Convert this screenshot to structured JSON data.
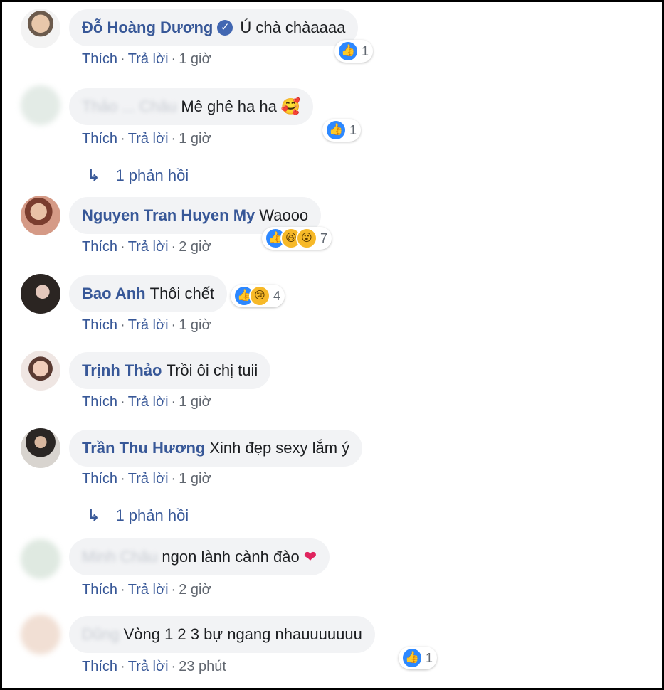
{
  "comments": [
    {
      "name": "Đỗ Hoàng Dương",
      "verified": true,
      "text": "Ú chà chàaaaa",
      "emoji": "",
      "actions": {
        "like": "Thích",
        "reply": "Trả lời",
        "time": "1 giờ"
      },
      "reaction_count": "1",
      "reaction_icons": [
        "like-icon"
      ]
    },
    {
      "name": "Thảo ... Châu",
      "text": "Mê ghê ha ha",
      "emoji": "🥰",
      "actions": {
        "like": "Thích",
        "reply": "Trả lời",
        "time": "1 giờ"
      },
      "reaction_count": "1",
      "reaction_icons": [
        "like-icon"
      ],
      "replies": "1 phản hồi"
    },
    {
      "name": "Nguyen Tran Huyen My",
      "text": "Waooo",
      "actions": {
        "like": "Thích",
        "reply": "Trả lời",
        "time": "2 giờ"
      },
      "reaction_count": "7",
      "reaction_icons": [
        "like-icon",
        "haha-icon",
        "wow-icon"
      ]
    },
    {
      "name": "Bao Anh",
      "text": "Thôi chết",
      "actions": {
        "like": "Thích",
        "reply": "Trả lời",
        "time": "1 giờ"
      },
      "reaction_count": "4",
      "reaction_icons": [
        "like-icon",
        "sad-icon"
      ]
    },
    {
      "name": "Trịnh Thảo",
      "text": "Trồi ôi chị tuii",
      "actions": {
        "like": "Thích",
        "reply": "Trả lời",
        "time": "1 giờ"
      }
    },
    {
      "name": "Trần Thu Hương",
      "text": "Xinh đẹp sexy lắm ý",
      "actions": {
        "like": "Thích",
        "reply": "Trả lời",
        "time": "1 giờ"
      },
      "replies": "1 phản hồi"
    },
    {
      "name": "Minh Châu",
      "text": "ngon lành cành đào",
      "emoji": "❤",
      "actions": {
        "like": "Thích",
        "reply": "Trả lời",
        "time": "2 giờ"
      }
    },
    {
      "name": "Dũng",
      "text": "Vòng 1 2 3 bự ngang nhauuuuuuu",
      "actions": {
        "like": "Thích",
        "reply": "Trả lời",
        "time": "23 phút"
      },
      "reaction_count": "1",
      "reaction_icons": [
        "like-icon"
      ]
    }
  ],
  "icons": {
    "reply_arrow": "reply-arrow-icon",
    "verified": "verified-badge-icon"
  },
  "colors": {
    "name": "#385898",
    "bubble": "#f2f3f5",
    "like": "#2d88ff"
  }
}
